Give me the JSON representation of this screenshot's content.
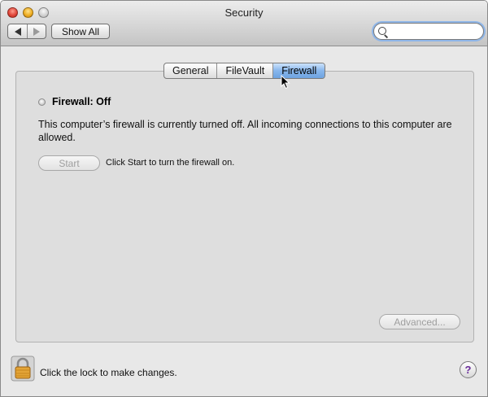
{
  "window": {
    "title": "Security"
  },
  "toolbar": {
    "back_icon": "back-arrow-icon",
    "forward_icon": "forward-arrow-icon",
    "show_all_label": "Show All",
    "search": {
      "value": "",
      "placeholder": ""
    }
  },
  "tabs": [
    {
      "label": "General",
      "active": false
    },
    {
      "label": "FileVault",
      "active": false
    },
    {
      "label": "Firewall",
      "active": true
    }
  ],
  "firewall": {
    "status_title": "Firewall: Off",
    "description": "This computer’s firewall is currently turned off. All incoming connections to this computer are allowed.",
    "start_label": "Start",
    "start_hint": "Click Start to turn the firewall on.",
    "advanced_label": "Advanced..."
  },
  "footer": {
    "lock_hint": "Click the lock to make changes.",
    "help_label": "?"
  },
  "colors": {
    "active_tab": "#86b6ec",
    "window_bg": "#e8e8e8",
    "help_glyph": "#6a2c9a"
  }
}
